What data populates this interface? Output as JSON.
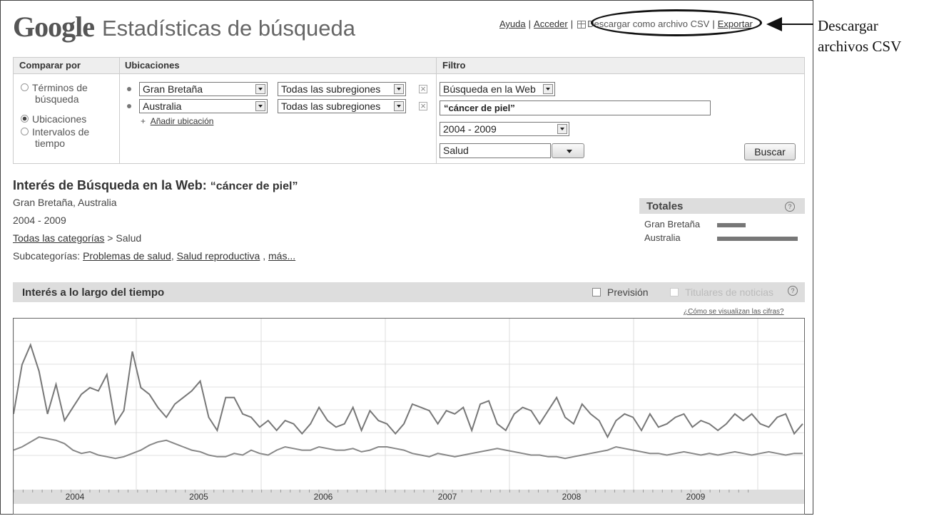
{
  "header": {
    "logo": "Google",
    "title": "Estadísticas de búsqueda",
    "links": {
      "help": "Ayuda",
      "sign_in": "Acceder",
      "download_csv": "Descargar como archivo CSV",
      "exportar": "Exportar"
    },
    "annotation_line1": "Descargar",
    "annotation_line2": "archivos CSV"
  },
  "filters": {
    "compare_heading": "Comparar por",
    "locations_heading": "Ubicaciones",
    "filter_heading": "Filtro",
    "compare_options": [
      {
        "line1": "Términos de",
        "line2": "búsqueda",
        "selected": false
      },
      {
        "line1": "Ubicaciones",
        "line2": "",
        "selected": true
      },
      {
        "line1": "Intervalos de",
        "line2": "tiempo",
        "selected": false
      }
    ],
    "locations": [
      {
        "country": "Gran Bretaña",
        "subregion": "Todas las subregiones"
      },
      {
        "country": "Australia",
        "subregion": "Todas las subregiones"
      }
    ],
    "add_location": "Añadir ubicación",
    "search_type": "Búsqueda en la Web",
    "query": "“cáncer de piel”",
    "date_range": "2004 - 2009",
    "category": "Salud",
    "search_button": "Buscar"
  },
  "results": {
    "title_prefix": "Interés de Búsqueda en la Web:",
    "title_query": "“cáncer de piel”",
    "locations_line": "Gran Bretaña, Australia",
    "date_line": "2004 - 2009",
    "all_categories": "Todas las categorías",
    "category_sep": ">",
    "category": "Salud",
    "subcat_label": "Subcategorías:",
    "subcats": [
      "Problemas de salud",
      "Salud reproductiva",
      "más..."
    ],
    "totals_label": "Totales",
    "totals": [
      {
        "name": "Gran Bretaña",
        "value": 0.36
      },
      {
        "name": "Australia",
        "value": 1.0
      }
    ]
  },
  "chart_panel": {
    "title": "Interés a lo largo del tiempo",
    "forecast": "Previsión",
    "news": "Titulares de noticias",
    "how_link": "¿Cómo se visualizan las cifras?"
  },
  "chart_data": {
    "type": "line",
    "x_tick_labels": [
      "2004",
      "2005",
      "2006",
      "2007",
      "2008",
      "2009"
    ],
    "grid": true,
    "legend": "none",
    "series": [
      {
        "values": [
          2.3,
          3.8,
          4.4,
          3.6,
          2.3,
          3.2,
          2.1,
          2.5,
          2.9,
          3.1,
          3.0,
          3.5,
          2.0,
          2.4,
          4.2,
          3.1,
          2.9,
          2.5,
          2.2,
          2.6,
          2.8,
          3.0,
          3.3,
          2.2,
          1.8,
          2.8,
          2.8,
          2.3,
          2.2,
          1.9,
          2.1,
          1.8,
          2.1,
          2.0,
          1.7,
          2.0,
          2.5,
          2.1,
          1.9,
          2.0,
          2.5,
          1.8,
          2.4,
          2.1,
          2.0,
          1.7,
          2.0,
          2.6,
          2.5,
          2.4,
          2.0,
          2.4,
          2.3,
          2.5,
          1.8,
          2.6,
          2.7,
          2.0,
          1.8,
          2.3,
          2.5,
          2.4,
          2.0,
          2.4,
          2.8,
          2.2,
          2.0,
          2.6,
          2.3,
          2.1,
          1.6,
          2.1,
          2.3,
          2.2,
          1.8,
          2.3,
          1.9,
          2.0,
          2.2,
          2.3,
          1.9,
          2.1,
          2.0,
          1.8,
          2.0,
          2.3,
          2.1,
          2.3,
          2.0,
          1.9,
          2.2,
          2.3,
          1.7,
          2.0
        ]
      },
      {
        "values": [
          1.2,
          1.3,
          1.45,
          1.6,
          1.55,
          1.5,
          1.4,
          1.2,
          1.1,
          1.15,
          1.05,
          1.0,
          0.95,
          1.0,
          1.1,
          1.2,
          1.35,
          1.45,
          1.5,
          1.4,
          1.3,
          1.2,
          1.15,
          1.05,
          1.0,
          1.0,
          1.1,
          1.05,
          1.2,
          1.1,
          1.05,
          1.2,
          1.3,
          1.25,
          1.2,
          1.2,
          1.3,
          1.25,
          1.2,
          1.2,
          1.25,
          1.15,
          1.2,
          1.3,
          1.3,
          1.25,
          1.2,
          1.1,
          1.05,
          1.0,
          1.1,
          1.05,
          1.0,
          1.05,
          1.1,
          1.15,
          1.2,
          1.25,
          1.2,
          1.15,
          1.1,
          1.05,
          1.05,
          1.0,
          1.0,
          0.95,
          1.0,
          1.05,
          1.1,
          1.15,
          1.2,
          1.3,
          1.25,
          1.2,
          1.15,
          1.1,
          1.1,
          1.05,
          1.1,
          1.15,
          1.1,
          1.05,
          1.1,
          1.05,
          1.1,
          1.15,
          1.1,
          1.05,
          1.1,
          1.15,
          1.1,
          1.05,
          1.1,
          1.1
        ]
      }
    ],
    "ylim": [
      0,
      5.2
    ]
  }
}
